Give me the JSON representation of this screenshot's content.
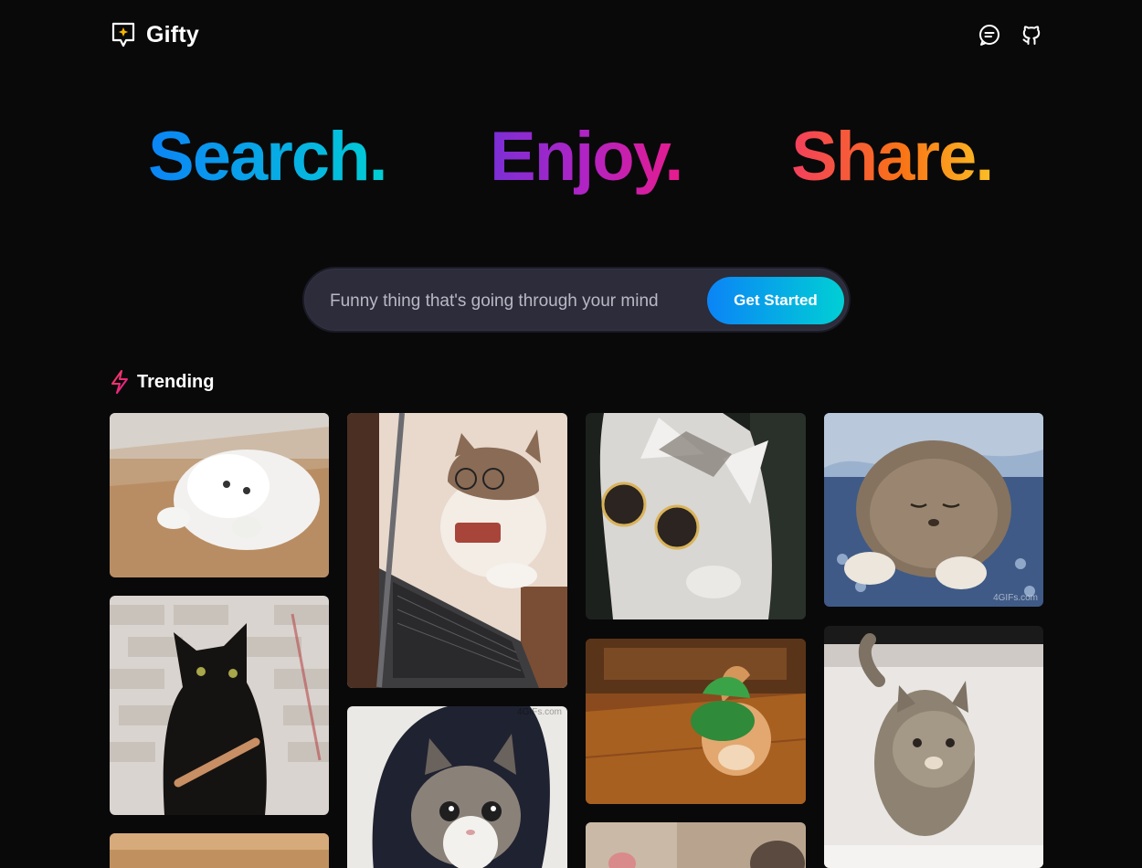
{
  "header": {
    "brand_name": "Gifty",
    "logo_icon": "gift-message-icon",
    "icons": [
      "chat-icon",
      "github-icon"
    ]
  },
  "hero": {
    "words": [
      "Search.",
      "Enjoy.",
      "Share."
    ]
  },
  "search": {
    "placeholder": "Funny thing that's going through your mind",
    "value": "",
    "button_label": "Get Started"
  },
  "trending": {
    "title": "Trending",
    "icon": "lightning-icon",
    "items": [
      {
        "subject": "white cat lying on floor",
        "watermark": ""
      },
      {
        "subject": "black cat with nail file",
        "watermark": ""
      },
      {
        "subject": "partial gif",
        "watermark": ""
      },
      {
        "subject": "cat with glasses at laptop",
        "watermark": ""
      },
      {
        "subject": "tabby cat stalking",
        "watermark": "4GIFs.com"
      },
      {
        "subject": "cat wearing sunglasses",
        "watermark": ""
      },
      {
        "subject": "kitten with green hat",
        "watermark": ""
      },
      {
        "subject": "partial gif",
        "watermark": ""
      },
      {
        "subject": "sleepy fluffy kitten",
        "watermark": "4GIFs.com"
      },
      {
        "subject": "tabby cat on white sofa",
        "watermark": ""
      }
    ]
  },
  "colors": {
    "background": "#09090a",
    "accent_blue": "#0b84f6",
    "accent_cyan": "#00cfd5",
    "accent_purple": "#7a2fd6",
    "accent_pink": "#e81b8c",
    "accent_red": "#f43f5e",
    "accent_orange": "#fbbf24"
  }
}
